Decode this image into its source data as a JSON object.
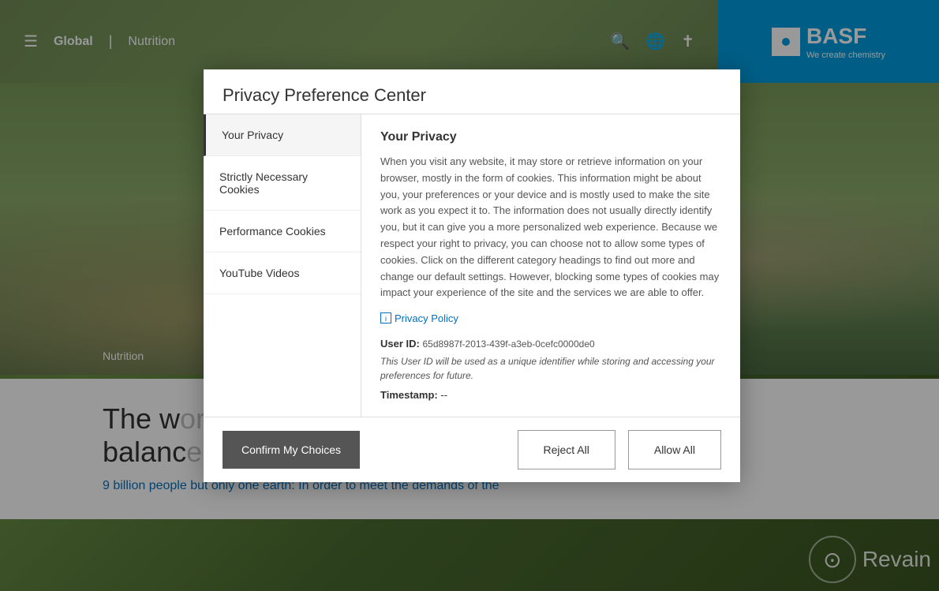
{
  "page": {
    "title": "Privacy Preference Center"
  },
  "topbar": {
    "menu_label": "☰",
    "global_label": "Global",
    "divider": "|",
    "nutrition_label": "Nutrition",
    "search_icon": "🔍",
    "globe_icon": "🌐",
    "cross_icon": "✝"
  },
  "basf": {
    "name": "BASF",
    "tagline": "We create chemistry"
  },
  "modal": {
    "title": "Privacy Preference Center",
    "sidebar": {
      "items": [
        {
          "id": "your-privacy",
          "label": "Your Privacy",
          "active": true
        },
        {
          "id": "strictly-necessary",
          "label": "Strictly Necessary Cookies",
          "active": false
        },
        {
          "id": "performance",
          "label": "Performance Cookies",
          "active": false
        },
        {
          "id": "youtube",
          "label": "YouTube Videos",
          "active": false
        }
      ]
    },
    "content": {
      "title": "Your Privacy",
      "description": "When you visit any website, it may store or retrieve information on your browser, mostly in the form of cookies. This information might be about you, your preferences or your device and is mostly used to make the site work as you expect it to. The information does not usually directly identify you, but it can give you a more personalized web experience. Because we respect your right to privacy, you can choose not to allow some types of cookies. Click on the different category headings to find out more and change our default settings. However, blocking some types of cookies may impact your experience of the site and the services we are able to offer.",
      "privacy_link_label": "Privacy Policy",
      "user_id_label": "User ID:",
      "user_id_value": "65d8987f-2013-439f-a3eb-0cefc0000de0",
      "user_id_note": "This User ID will be used as a unique identifier while storing and accessing your preferences for future.",
      "timestamp_label": "Timestamp:",
      "timestamp_value": "--"
    },
    "footer": {
      "confirm_label": "Confirm My Choices",
      "reject_label": "Reject All",
      "allow_label": "Allow All"
    }
  },
  "background": {
    "nutrition_label": "Nutrition"
  },
  "main_content": {
    "heading_partial": "The w",
    "heading_partial2": "balanc",
    "subtext": "9 billion people but only one earth: In order to meet the demands of the"
  },
  "watermark": {
    "text": "Revain"
  }
}
